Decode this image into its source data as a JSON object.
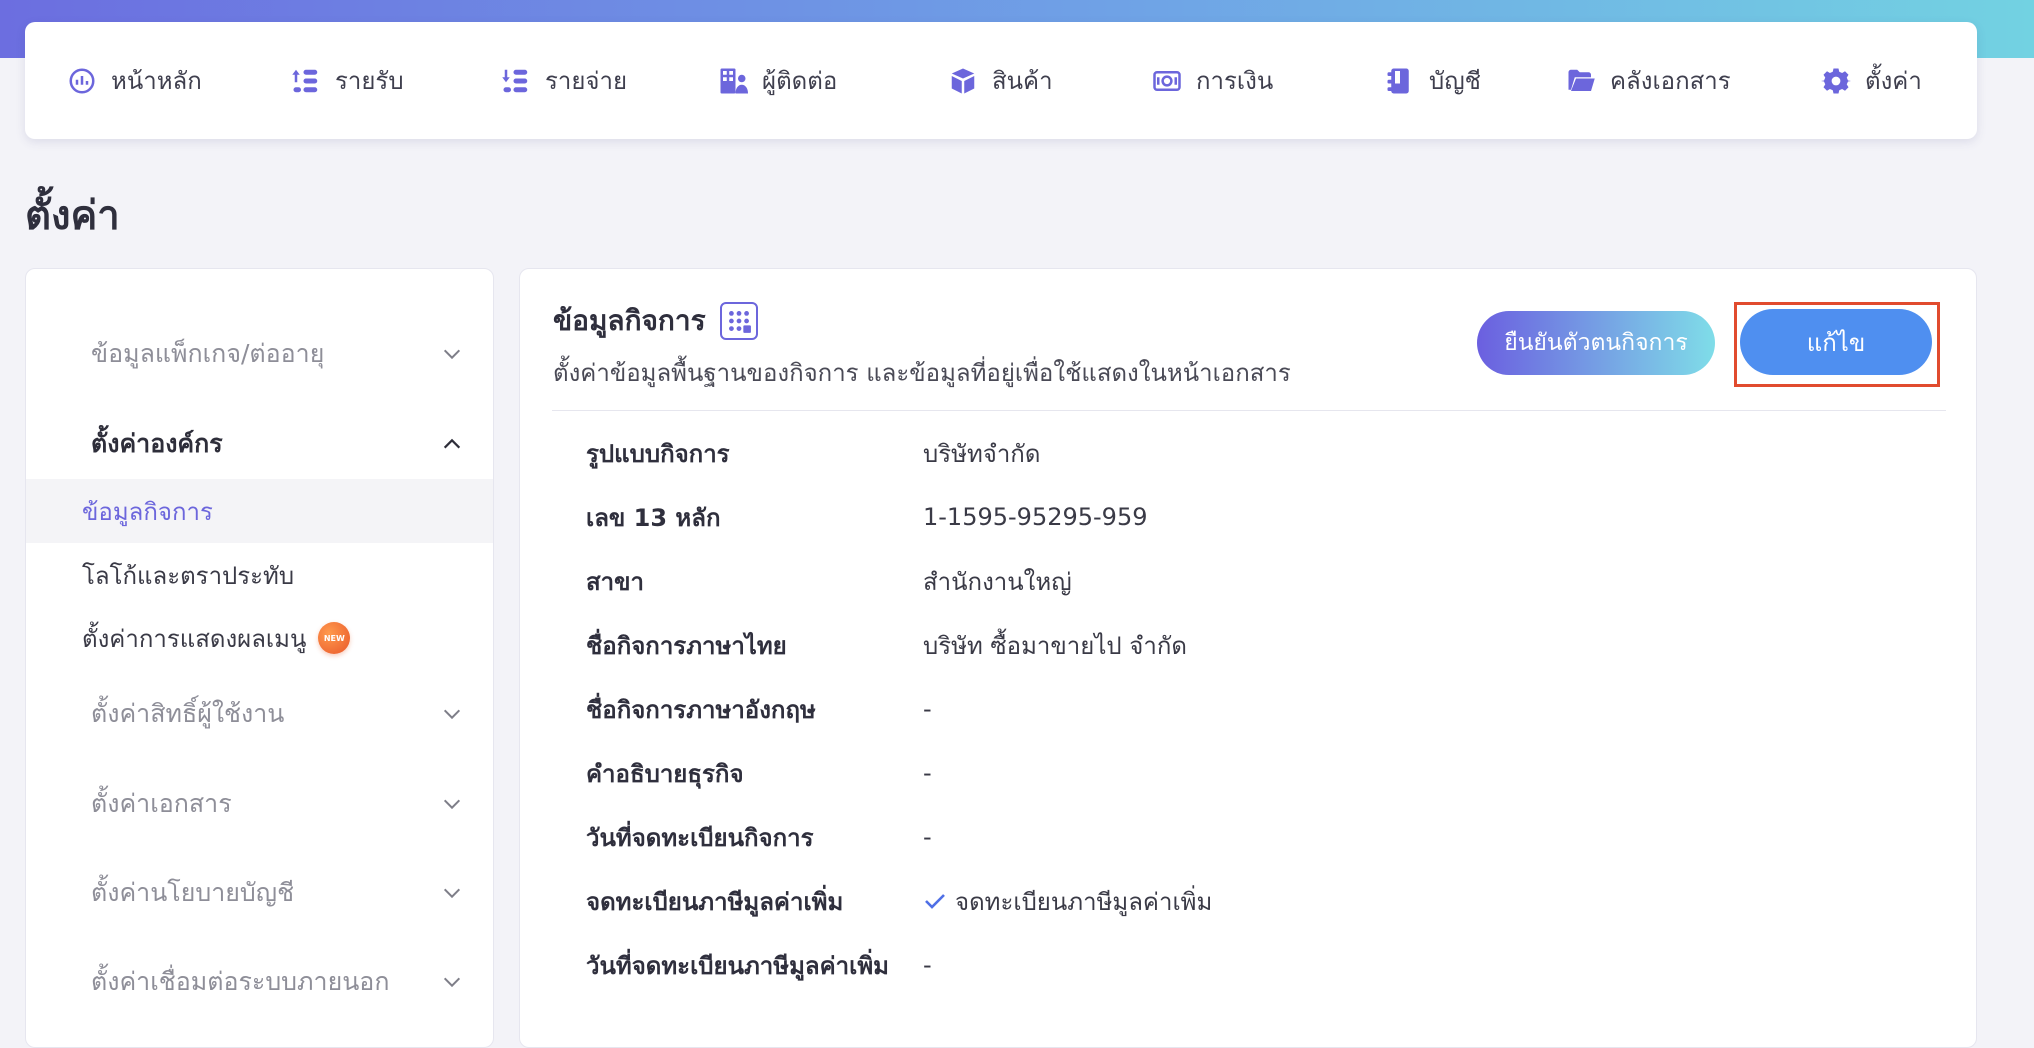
{
  "topnav": {
    "items": [
      {
        "label": "หน้าหลัก",
        "icon": "dashboard-icon"
      },
      {
        "label": "รายรับ",
        "icon": "income-icon"
      },
      {
        "label": "รายจ่าย",
        "icon": "expense-icon"
      },
      {
        "label": "ผู้ติดต่อ",
        "icon": "contacts-icon"
      },
      {
        "label": "สินค้า",
        "icon": "product-box-icon"
      },
      {
        "label": "การเงิน",
        "icon": "money-icon"
      },
      {
        "label": "บัญชี",
        "icon": "ledger-icon"
      },
      {
        "label": "คลังเอกสาร",
        "icon": "folder-icon"
      },
      {
        "label": "ตั้งค่า",
        "icon": "gear-icon"
      }
    ]
  },
  "page": {
    "title": "ตั้งค่า"
  },
  "sidebar": {
    "package_group": "ข้อมูลแพ็กเกจ/ต่ออายุ",
    "org_group": "ตั้งค่าองค์กร",
    "org_items": [
      "ข้อมูลกิจการ",
      "โลโก้และตราประทับ",
      "ตั้งค่าการแสดงผลเมนู"
    ],
    "new_badge": "NEW",
    "permission_group": "ตั้งค่าสิทธิ์ผู้ใช้งาน",
    "document_group": "ตั้งค่าเอกสาร",
    "accounting_group": "ตั้งค่านโยบายบัญชี",
    "integration_group": "ตั้งค่าเชื่อมต่อระบบภายนอก"
  },
  "card": {
    "title": "ข้อมูลกิจการ",
    "subtitle": "ตั้งค่าข้อมูลพื้นฐานของกิจการ และข้อมูลที่อยู่เพื่อใช้แสดงในหน้าเอกสาร",
    "verify_button": "ยืนยันตัวตนกิจการ",
    "edit_button": "แก้ไข",
    "rows": [
      {
        "label": "รูปแบบกิจการ",
        "value": "บริษัทจำกัด"
      },
      {
        "label": "เลข 13 หลัก",
        "value": "1-1595-95295-959"
      },
      {
        "label": "สาขา",
        "value": "สำนักงานใหญ่"
      },
      {
        "label": "ชื่อกิจการภาษาไทย",
        "value": "บริษัท ซื้อมาขายไป จำกัด"
      },
      {
        "label": "ชื่อกิจการภาษาอังกฤษ",
        "value": "-"
      },
      {
        "label": "คำอธิบายธุรกิจ",
        "value": "-"
      },
      {
        "label": "วันที่จดทะเบียนกิจการ",
        "value": "-"
      },
      {
        "label": "จดทะเบียนภาษีมูลค่าเพิ่ม",
        "value": "จดทะเบียนภาษีมูลค่าเพิ่ม"
      },
      {
        "label": "วันที่จดทะเบียนภาษีมูลค่าเพิ่ม",
        "value": "-"
      }
    ]
  },
  "colors": {
    "accent": "#6c66dc",
    "edit_button": "#4f8ff0",
    "highlight_frame": "#e14b2e"
  }
}
